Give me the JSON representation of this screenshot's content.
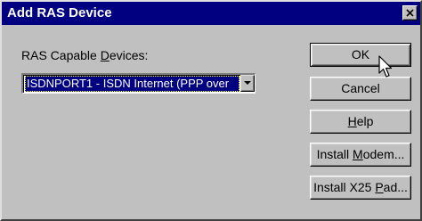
{
  "window": {
    "title": "Add RAS Device",
    "close_glyph": "✕"
  },
  "devices": {
    "label_prefix": "RAS Capable ",
    "label_mnemonic": "D",
    "label_suffix": "evices:",
    "selected_value": "ISDNPORT1 - ISDN Internet (PPP over"
  },
  "buttons": {
    "ok": {
      "label": "OK"
    },
    "cancel": {
      "label": "Cancel"
    },
    "help": {
      "mnemonic": "H",
      "rest": "elp"
    },
    "install_modem": {
      "prefix": "Install ",
      "mnemonic": "M",
      "rest": "odem..."
    },
    "install_x25": {
      "prefix": "Install X25 ",
      "mnemonic": "P",
      "rest": "ad..."
    }
  },
  "icons": {
    "close": "close-icon",
    "dropdown": "chevron-down-icon",
    "cursor": "mouse-pointer-icon"
  },
  "colors": {
    "titlebar": "#000080",
    "face": "#c0c0c0",
    "selection": "#000080"
  }
}
